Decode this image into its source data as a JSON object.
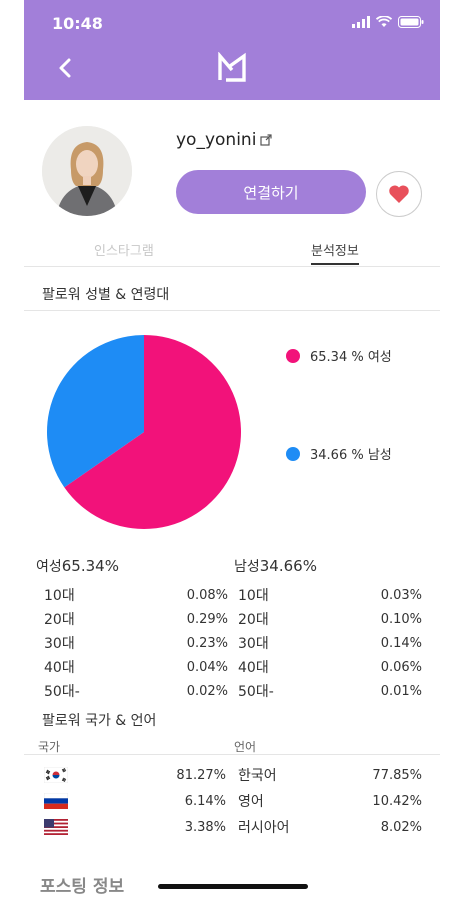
{
  "status_bar": {
    "time": "10:48"
  },
  "profile": {
    "username": "yo_yonini",
    "connect_label": "연결하기"
  },
  "tabs": [
    {
      "label": "인스타그램",
      "active": false
    },
    {
      "label": "분석정보",
      "active": true
    }
  ],
  "gender_age_section": {
    "title": "팔로워 성별 & 연령대",
    "legend": [
      {
        "label": "65.34 % 여성",
        "color": "#f2127a"
      },
      {
        "label": "34.66 % 남성",
        "color": "#1e8cf5"
      }
    ],
    "female": {
      "label": "여성",
      "percent": "65.34%",
      "ages": [
        {
          "age": "10대",
          "value": "0.08%"
        },
        {
          "age": "20대",
          "value": "0.29%"
        },
        {
          "age": "30대",
          "value": "0.23%"
        },
        {
          "age": "40대",
          "value": "0.04%"
        },
        {
          "age": "50대-",
          "value": "0.02%"
        }
      ]
    },
    "male": {
      "label": "남성",
      "percent": "34.66%",
      "ages": [
        {
          "age": "10대",
          "value": "0.03%"
        },
        {
          "age": "20대",
          "value": "0.10%"
        },
        {
          "age": "30대",
          "value": "0.14%"
        },
        {
          "age": "40대",
          "value": "0.06%"
        },
        {
          "age": "50대-",
          "value": "0.01%"
        }
      ]
    }
  },
  "country_language_section": {
    "title": "팔로워 국가 & 언어",
    "country_label": "국가",
    "language_label": "언어",
    "countries": [
      {
        "flag": "korea-flag-icon",
        "value": "81.27%"
      },
      {
        "flag": "russia-flag-icon",
        "value": "6.14%"
      },
      {
        "flag": "usa-flag-icon",
        "value": "3.38%"
      }
    ],
    "languages": [
      {
        "name": "한국어",
        "value": "77.85%"
      },
      {
        "name": "영어",
        "value": "10.42%"
      },
      {
        "name": "러시아어",
        "value": "8.02%"
      }
    ]
  },
  "posting_section": {
    "title": "포스팅 정보"
  },
  "chart_data": {
    "type": "pie",
    "title": "",
    "slices": [
      {
        "label": "여성",
        "value": 65.34,
        "color": "#f2127a"
      },
      {
        "label": "남성",
        "value": 34.66,
        "color": "#1e8cf5"
      }
    ]
  },
  "colors": {
    "accent": "#a27fd9",
    "female": "#f2127a",
    "male": "#1e8cf5",
    "heart": "#e8505b"
  }
}
